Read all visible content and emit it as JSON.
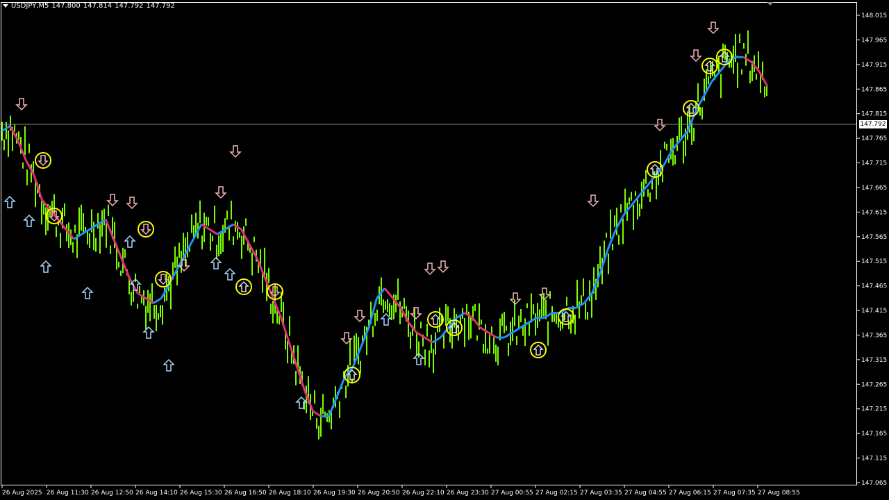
{
  "header": {
    "symbol": "USDJPY,M5",
    "open": "147.800",
    "high": "147.814",
    "low": "147.792",
    "close": "147.792"
  },
  "current_price_label": "147.792",
  "y_axis": {
    "labels": [
      "148.015",
      "147.965",
      "147.915",
      "147.865",
      "147.815",
      "147.765",
      "147.715",
      "147.665",
      "147.615",
      "147.565",
      "147.515",
      "147.465",
      "147.415",
      "147.365",
      "147.315",
      "147.265",
      "147.215",
      "147.165",
      "147.115",
      "147.065"
    ],
    "min": 147.065,
    "max": 148.015
  },
  "x_axis": {
    "labels": [
      "26 Aug 2025",
      "26 Aug 11:30",
      "26 Aug 12:50",
      "26 Aug 14:10",
      "26 Aug 15:30",
      "26 Aug 16:50",
      "26 Aug 18:10",
      "26 Aug 19:30",
      "26 Aug 20:50",
      "26 Aug 22:10",
      "26 Aug 23:30",
      "27 Aug 00:55",
      "27 Aug 02:15",
      "27 Aug 03:35",
      "27 Aug 04:55",
      "27 Aug 06:15",
      "27 Aug 07:35",
      "27 Aug 08:55"
    ]
  },
  "colors": {
    "background": "#000000",
    "bars": "#7cfc00",
    "trend_up": "#1e90ff",
    "trend_down": "#e0307a",
    "arrow_up": "#a8d8ff",
    "arrow_down": "#f4b6b6",
    "circle": "#ffff00",
    "grid_axis": "#ffffff"
  },
  "chart_data": {
    "type": "line",
    "series": [
      {
        "values": [
          147.78,
          147.79,
          147.76,
          147.72,
          147.69,
          147.64,
          147.62,
          147.6,
          147.58,
          147.56,
          147.57,
          147.58,
          147.59,
          147.6,
          147.56,
          147.52,
          147.48,
          147.45,
          147.44,
          147.43,
          147.44,
          147.47,
          147.5,
          147.53,
          147.56,
          147.59,
          147.58,
          147.57,
          147.58,
          147.59,
          147.58,
          147.55,
          147.52,
          147.48,
          147.44,
          147.4,
          147.35,
          147.3,
          147.25,
          147.21,
          147.2,
          147.2,
          147.24,
          147.28,
          147.3,
          147.34,
          147.38,
          147.44,
          147.46,
          147.44,
          147.42,
          147.39,
          147.37,
          147.36,
          147.35,
          147.36,
          147.38,
          147.4,
          147.41,
          147.4,
          147.38,
          147.37,
          147.36,
          147.36,
          147.37,
          147.38,
          147.39,
          147.4,
          147.4,
          147.41,
          147.41,
          147.42,
          147.42,
          147.43,
          147.45,
          147.49,
          147.54,
          147.58,
          147.61,
          147.63,
          147.65,
          147.67,
          147.69,
          147.71,
          147.74,
          147.76,
          147.78,
          147.82,
          147.85,
          147.88,
          147.9,
          147.92,
          147.93,
          147.93,
          147.92,
          147.9,
          147.87
        ]
      }
    ],
    "up_arrows": 24,
    "down_arrows": 26,
    "highlighted_signals": 18
  }
}
